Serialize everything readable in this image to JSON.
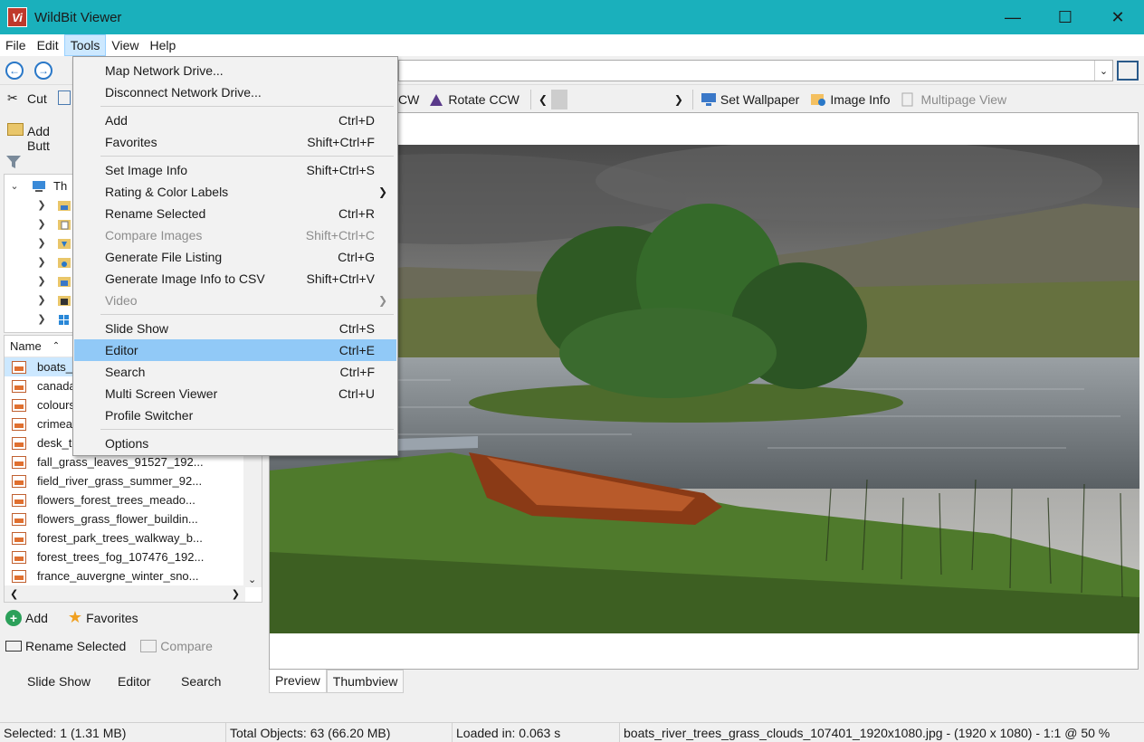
{
  "window": {
    "title": "WildBit Viewer",
    "logo_text": "Vi"
  },
  "menubar": [
    "File",
    "Edit",
    "Tools",
    "View",
    "Help"
  ],
  "left_toolbar": {
    "cut": "Cut",
    "add_button": "Add Butt"
  },
  "main_toolbar": {
    "partial_left": "CW",
    "rotate_ccw": "Rotate CCW",
    "set_wallpaper": "Set Wallpaper",
    "image_info": "Image Info",
    "multipage_view": "Multipage View"
  },
  "tree": {
    "root_label": "Th"
  },
  "file_list": {
    "column": "Name",
    "files": [
      "boats_",
      "canada",
      "colours",
      "crimea",
      "desk_t",
      "fall_grass_leaves_91527_192...",
      "field_river_grass_summer_92...",
      "flowers_forest_trees_meado...",
      "flowers_grass_flower_buildin...",
      "forest_park_trees_walkway_b...",
      "forest_trees_fog_107476_192...",
      "france_auvergne_winter_sno..."
    ]
  },
  "bottom_left": {
    "add": "Add",
    "favorites": "Favorites",
    "rename_selected": "Rename Selected",
    "compare": "Compare",
    "slide_show": "Slide Show",
    "editor": "Editor",
    "search": "Search"
  },
  "tabs": [
    "Preview",
    "Thumbview"
  ],
  "status": {
    "selected": "Selected: 1 (1.31 MB)",
    "total": "Total Objects: 63 (66.20 MB)",
    "loaded": "Loaded in: 0.063 s",
    "file": "boats_river_trees_grass_clouds_107401_1920x1080.jpg - (1920 x 1080) - 1:1 @ 50 %"
  },
  "tools_menu": {
    "items": [
      {
        "label": "Map Network Drive...",
        "shortcut": ""
      },
      {
        "label": "Disconnect Network Drive...",
        "shortcut": ""
      },
      {
        "label": "Add",
        "shortcut": "Ctrl+D"
      },
      {
        "label": "Favorites",
        "shortcut": "Shift+Ctrl+F"
      },
      {
        "label": "Set Image Info",
        "shortcut": "Shift+Ctrl+S"
      },
      {
        "label": "Rating & Color Labels",
        "shortcut": ""
      },
      {
        "label": "Rename Selected",
        "shortcut": "Ctrl+R"
      },
      {
        "label": "Compare Images",
        "shortcut": "Shift+Ctrl+C"
      },
      {
        "label": "Generate File Listing",
        "shortcut": "Ctrl+G"
      },
      {
        "label": "Generate Image Info to CSV",
        "shortcut": "Shift+Ctrl+V"
      },
      {
        "label": "Video",
        "shortcut": ""
      },
      {
        "label": "Slide Show",
        "shortcut": "Ctrl+S"
      },
      {
        "label": "Editor",
        "shortcut": "Ctrl+E"
      },
      {
        "label": "Search",
        "shortcut": "Ctrl+F"
      },
      {
        "label": "Multi Screen Viewer",
        "shortcut": "Ctrl+U"
      },
      {
        "label": "Profile Switcher",
        "shortcut": ""
      },
      {
        "label": "Options",
        "shortcut": ""
      }
    ],
    "highlighted": "Editor",
    "disabled": [
      "Compare Images",
      "Video"
    ],
    "submenu_items": [
      "Rating & Color Labels",
      "Video"
    ]
  },
  "colors": {
    "titlebar": "#1ab0bc",
    "menu_highlight": "#91c9f7",
    "selection": "#cce8ff"
  }
}
